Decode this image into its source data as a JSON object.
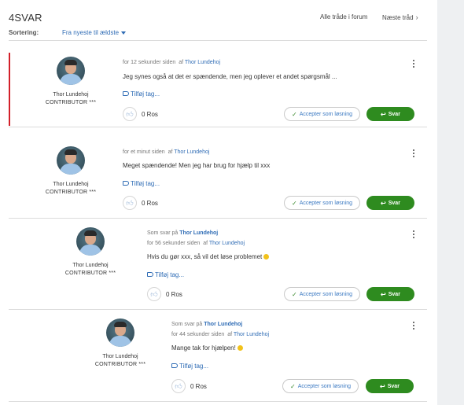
{
  "header": {
    "title": "4SVAR",
    "all_threads": "Alle tråde i forum",
    "next_thread": "Næste tråd",
    "sort_label": "Sortering:",
    "sort_value": "Fra nyeste til ældste"
  },
  "labels": {
    "add_tag": "Tilføj tag...",
    "accept": "Accepter som løsning",
    "reply": "Svar",
    "reply_to_prefix": "Som svar på",
    "by": "af"
  },
  "posts": [
    {
      "author": "Thor Lundehoj",
      "role": "CONTRIBUTOR ***",
      "time": "for 12 sekunder siden",
      "by_name": "Thor Lundehoj",
      "reply_to": "",
      "body": "Jeg synes også at det er spændende, men jeg oplever et andet spørgsmål ...",
      "kudos": "0 Ros",
      "highlighted": true
    },
    {
      "author": "Thor Lundehoj",
      "role": "CONTRIBUTOR ***",
      "time": "for et minut siden",
      "by_name": "Thor Lundehoj",
      "reply_to": "",
      "body": "Meget spændende! Men jeg har brug for hjælp til xxx",
      "kudos": "0 Ros"
    },
    {
      "author": "Thor Lundehoj",
      "role": "CONTRIBUTOR ***",
      "time": "for 56 sekunder siden",
      "by_name": "Thor Lundehoj",
      "reply_to": "Thor Lundehoj",
      "body": "Hvis du gør xxx, så vil det løse problemet",
      "kudos": "0 Ros"
    },
    {
      "author": "Thor Lundehoj",
      "role": "CONTRIBUTOR ***",
      "time": "for 44 sekunder siden",
      "by_name": "Thor Lundehoj",
      "reply_to": "Thor Lundehoj",
      "body": "Mange tak for hjælpen!",
      "kudos": "0 Ros"
    }
  ],
  "colors": {
    "accent": "#2f6cb5",
    "reply_green": "#2e8b1f",
    "highlight_red": "#d3202a"
  },
  "icons": [
    "chevron-right-icon",
    "caret-down-icon",
    "tag-icon",
    "thumbs-up-icon",
    "check-icon",
    "reply-arrow-icon",
    "more-options-icon",
    "emoji-icon"
  ]
}
